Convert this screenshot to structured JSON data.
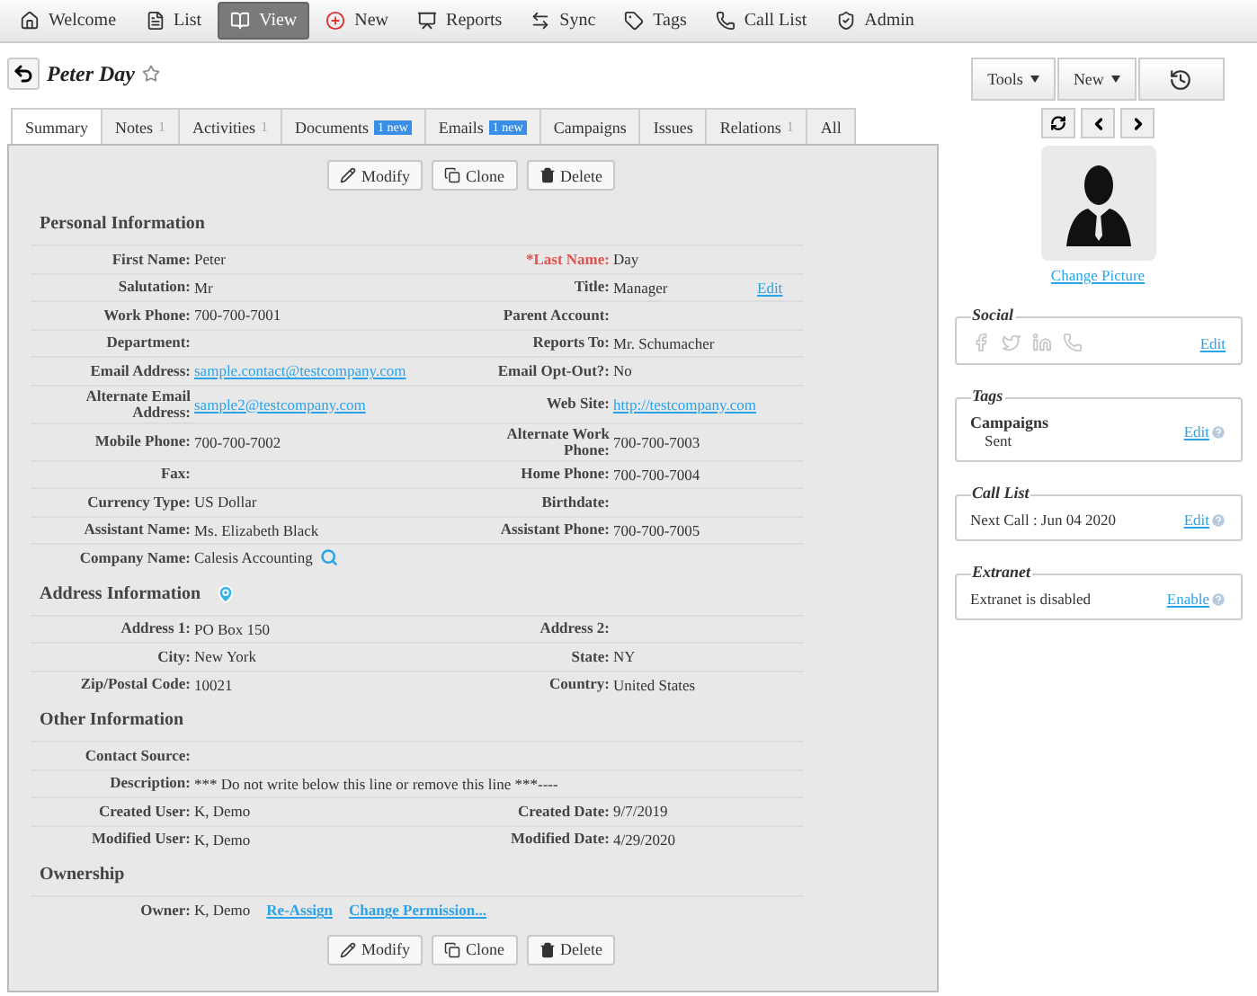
{
  "menu": [
    {
      "label": "Welcome",
      "selected": false
    },
    {
      "label": "List",
      "selected": false
    },
    {
      "label": "View",
      "selected": true
    },
    {
      "label": "New",
      "selected": false
    },
    {
      "label": "Reports",
      "selected": false
    },
    {
      "label": "Sync",
      "selected": false
    },
    {
      "label": "Tags",
      "selected": false
    },
    {
      "label": "Call List",
      "selected": false
    },
    {
      "label": "Admin",
      "selected": false
    }
  ],
  "record": {
    "title": "Peter Day",
    "favorite": false
  },
  "tabs": [
    {
      "label": "Summary",
      "selected": true
    },
    {
      "label": "Notes",
      "count": "1",
      "selected": false
    },
    {
      "label": "Activities",
      "count": "1",
      "selected": false
    },
    {
      "label": "Documents",
      "badge": "1 new",
      "selected": false
    },
    {
      "label": "Emails",
      "badge": "1 new",
      "selected": false
    },
    {
      "label": "Campaigns",
      "selected": false
    },
    {
      "label": "Issues",
      "selected": false
    },
    {
      "label": "Relations",
      "count": "1",
      "selected": false
    },
    {
      "label": "All",
      "selected": false
    }
  ],
  "actions_top": [
    "Modify",
    "Clone",
    "Delete"
  ],
  "sections": [
    {
      "title": "Personal Information",
      "map_marker": false,
      "rows": [
        {
          "cells": [
            {
              "label": "First Name:",
              "value": "Peter"
            },
            {
              "label": "*Last Name:",
              "value": "Day",
              "required": true
            }
          ]
        },
        {
          "cells": [
            {
              "label": "Salutation:",
              "value": "Mr"
            },
            {
              "label": "Title:",
              "value": "Manager"
            }
          ],
          "edit": "Edit"
        },
        {
          "cells": [
            {
              "label": "Work Phone:",
              "value": "700-700-7001"
            },
            {
              "label": "Parent Account:"
            }
          ]
        },
        {
          "cells": [
            {
              "label": "Department:"
            },
            {
              "label": "Reports To:",
              "value": "Mr. Schumacher"
            }
          ]
        },
        {
          "cells": [
            {
              "label": "Email Address:",
              "value": "sample.contact@testcompany.com",
              "kind": "link"
            },
            {
              "label": "Email Opt-Out?:",
              "value": "No"
            }
          ]
        },
        {
          "cells": [
            {
              "label": "Alternate Email Address:",
              "value": "sample2@testcompany.com",
              "kind": "link"
            },
            {
              "label": "Web Site:",
              "value": "http://testcompany.com",
              "kind": "link"
            }
          ]
        },
        {
          "cells": [
            {
              "label": "Mobile Phone:",
              "value": "700-700-7002"
            },
            {
              "label": "Alternate Work Phone:",
              "value": "700-700-7003"
            }
          ]
        },
        {
          "cells": [
            {
              "label": "Fax:"
            },
            {
              "label": "Home Phone:",
              "value": "700-700-7004"
            }
          ]
        },
        {
          "cells": [
            {
              "label": "Currency Type:",
              "value": "US Dollar"
            },
            {
              "label": "Birthdate:"
            }
          ]
        },
        {
          "cells": [
            {
              "label": "Assistant Name:",
              "value": "Ms. Elizabeth Black"
            },
            {
              "label": "Assistant Phone:",
              "value": "700-700-7005"
            }
          ]
        },
        {
          "cells": [
            {
              "label": "Company Name:",
              "value": "Calesis Accounting",
              "kind": "lookup"
            }
          ]
        }
      ]
    },
    {
      "title": "Address Information",
      "map_marker": true,
      "rows": [
        {
          "cells": [
            {
              "label": "Address 1:",
              "value": "PO Box 150"
            },
            {
              "label": "Address 2:"
            }
          ]
        },
        {
          "cells": [
            {
              "label": "City:",
              "value": "New York"
            },
            {
              "label": "State:",
              "value": "NY"
            }
          ]
        },
        {
          "cells": [
            {
              "label": "Zip/Postal Code:",
              "value": "10021"
            },
            {
              "label": "Country:",
              "value": "United States"
            }
          ]
        }
      ]
    },
    {
      "title": "Other Information",
      "map_marker": false,
      "rows": [
        {
          "cells": [
            {
              "label": "Contact Source:"
            }
          ]
        },
        {
          "cells": [
            {
              "label": "Description:",
              "value": "*** Do not write below this line or remove this line ***----",
              "kind": "wide"
            }
          ]
        },
        {
          "cells": [
            {
              "label": "Created User:",
              "value": "K, Demo"
            },
            {
              "label": "Created Date:",
              "value": "9/7/2019"
            }
          ]
        },
        {
          "cells": [
            {
              "label": "Modified User:",
              "value": "K, Demo"
            },
            {
              "label": "Modified Date:",
              "value": "4/29/2020"
            }
          ]
        }
      ]
    },
    {
      "title": "Ownership",
      "map_marker": false,
      "rows": [
        {
          "cells": [
            {
              "label": "Owner:",
              "value": "K, Demo",
              "links": [
                "Re-Assign",
                "Change Permission..."
              ]
            }
          ]
        }
      ]
    }
  ],
  "actions_bottom": [
    "Modify",
    "Clone",
    "Delete"
  ],
  "sidebar": {
    "tools": [
      {
        "label": "Tools",
        "kind": "dropdown"
      },
      {
        "label": "New",
        "kind": "dropdown"
      },
      {
        "kind": "history"
      }
    ],
    "change_picture": "Change Picture",
    "panels": [
      {
        "kind": "social",
        "title": "Social",
        "action": "Edit",
        "help": false
      },
      {
        "kind": "tags",
        "title": "Tags",
        "heading": "Campaigns",
        "text": "Sent",
        "action": "Edit",
        "help": true
      },
      {
        "kind": "text",
        "title": "Call List",
        "text": "Next Call : Jun 04 2020",
        "action": "Edit",
        "help": true
      },
      {
        "kind": "text",
        "title": "Extranet",
        "text": "Extranet is disabled",
        "action": "Enable",
        "help": true
      }
    ]
  }
}
